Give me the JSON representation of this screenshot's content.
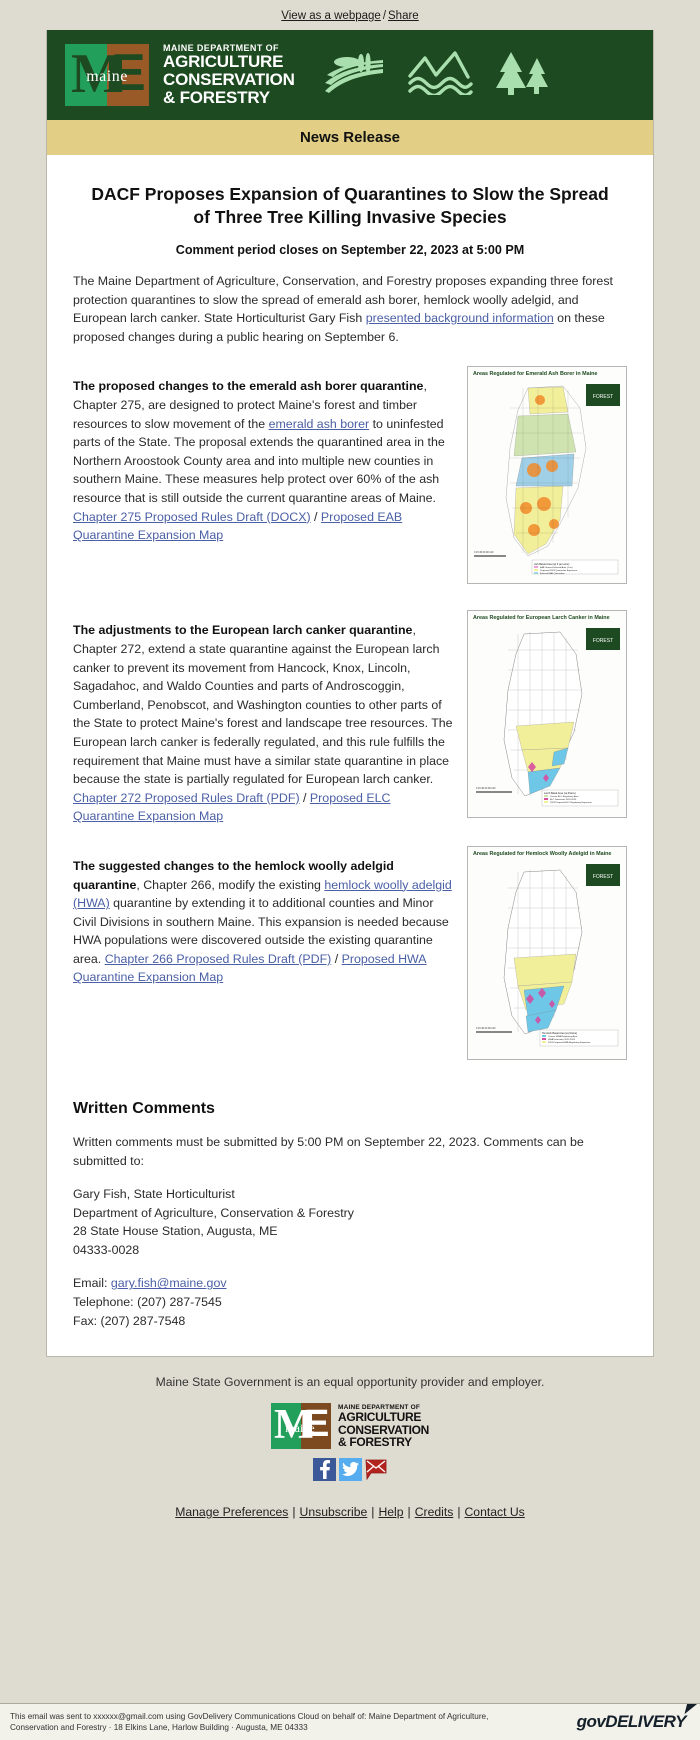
{
  "preheader": {
    "view_webpage": "View as a webpage",
    "separator": "/",
    "share": "Share"
  },
  "banner": {
    "logo_m": "M",
    "logo_e": "E",
    "logo_word": "maine",
    "dept_line1": "MAINE DEPARTMENT OF",
    "dept_line2": "AGRICULTURE",
    "dept_line3": "CONSERVATION",
    "dept_line4": "& FORESTRY",
    "icons": [
      "farm-field-icon",
      "mountain-water-icon",
      "pine-trees-icon"
    ]
  },
  "news_strip": {
    "label": "News Release"
  },
  "article": {
    "headline": "DACF Proposes Expansion of Quarantines to Slow the Spread of Three Tree Killing Invasive Species",
    "subhead": "Comment period closes on September 22, 2023 at 5:00 PM",
    "intro_part1": "The Maine Department of Agriculture, Conservation, and Forestry proposes expanding three forest protection quarantines to slow the spread of emerald ash borer, hemlock woolly adelgid, and European larch canker. State Horticulturist Gary Fish ",
    "intro_link": "presented background information",
    "intro_part2": " on these proposed changes during a public hearing on September 6."
  },
  "sections": [
    {
      "id": "eab",
      "lead_bold": "The proposed changes to the emerald ash borer quarantine",
      "text_1": ", Chapter 275, are designed to protect Maine's forest and timber resources to slow movement of the ",
      "inline_link": "emerald ash borer",
      "text_2": " to uninfested parts of the State. The proposal extends the quarantined area in the Northern Aroostook County area and into multiple new counties in southern Maine. These measures help protect over 60% of the ash resource that is still outside the current quarantine areas of Maine. ",
      "link_a": "Chapter 275 Proposed Rules Draft (DOCX)",
      "link_divider": " / ",
      "link_b": "Proposed EAB Quarantine Expansion Map",
      "map": {
        "name": "eab-quarantine-map",
        "caption": "Areas Regulated for Emerald Ash Borer in Maine",
        "legend_title": "Ash Basal Area (sq ft per acre)",
        "legend_items": [
          "EAB General Infested Area (1 mi)",
          "EAB Potential Infested Area (10 mi)",
          "Existing Maine EAB Quarantine",
          "Proposed 2023 Quarantine Expansion",
          "External EAB Quarantine",
          "Canada Non-Regulated Area"
        ]
      }
    },
    {
      "id": "elc",
      "lead_bold": "The adjustments to the European larch canker quarantine",
      "text_1": ", Chapter 272, extend a state quarantine against the European larch canker to prevent its movement from Hancock, Knox, Lincoln, Sagadahoc, and Waldo Counties and parts of Androscoggin, Cumberland, Penobscot, and Washington counties to other parts of the State to protect Maine's forest and landscape tree resources. The European larch canker is federally regulated, and this rule fulfills the requirement that Maine must have a similar state quarantine in place because the state is partially regulated for European larch canker. ",
      "inline_link": "",
      "text_2": "",
      "link_a": "Chapter 272 Proposed Rules Draft (PDF)",
      "link_divider": " / ",
      "link_b": "Proposed ELC Quarantine Expansion Map",
      "map": {
        "name": "elc-quarantine-map",
        "caption": "Areas Regulated for European Larch Canker in Maine",
        "legend_title": "Larch Basal Area (sq ft per acre)",
        "legend_items": [
          "Current ELC Regulatory Area",
          "ELC Detections 2022-2023",
          "2023 Proposed ELC Regulatory Expansion"
        ]
      }
    },
    {
      "id": "hwa",
      "lead_bold": "The suggested changes to the hemlock woolly adelgid quarantine",
      "text_1": ", Chapter 266, modify the existing ",
      "inline_link": "hemlock woolly adelgid (HWA)",
      "text_2": " quarantine by extending it to additional counties and Minor Civil Divisions in southern Maine. This expansion is needed because HWA populations were discovered outside the existing quarantine area. ",
      "link_a": "Chapter 266 Proposed Rules Draft (PDF)",
      "link_divider": " / ",
      "link_b": "Proposed HWA Quarantine Expansion Map",
      "map": {
        "name": "hwa-quarantine-map",
        "caption": "Areas Regulated for Hemlock Woolly Adelgid in Maine",
        "legend_title": "Hemlock Basal Area (sq ft per acre)",
        "legend_items": [
          "Current HWA Regulatory Area",
          "HWA Detections 2022-2023",
          "2023 Proposed HWA Regulatory Expansion"
        ]
      }
    }
  ],
  "written_comments": {
    "heading": "Written Comments",
    "line_1": "Written comments must be submitted by 5:00 PM on September 22, 2023. Comments can be submitted to:",
    "name": "Gary Fish, State Horticulturist",
    "department": "Department of Agriculture, Conservation & Forestry",
    "address": "28 State House Station, Augusta, ME",
    "zip": "04333-0028",
    "email_label": "Email: ",
    "email": "gary.fish@maine.gov",
    "telephone": "Telephone: (207) 287-7545",
    "fax": "Fax: (207) 287-7548"
  },
  "footer": {
    "eeo": "Maine State Government is an equal opportunity provider and employer.",
    "logo_m": "M",
    "logo_e": "E",
    "logo_word": "maine",
    "dept_line1": "MAINE DEPARTMENT OF",
    "dept_line2": "AGRICULTURE",
    "dept_line3": "CONSERVATION",
    "dept_line4": "& FORESTRY",
    "social": [
      {
        "name": "facebook-icon",
        "glyph": "f"
      },
      {
        "name": "twitter-icon",
        "glyph": "t"
      },
      {
        "name": "email-icon",
        "glyph": "m"
      }
    ],
    "links": [
      "Manage Preferences",
      "Unsubscribe",
      "Help",
      "Credits",
      "Contact Us"
    ],
    "separator": "|"
  },
  "govdelivery": {
    "text_line1": "This email was sent to xxxxxx@gmail.com using GovDelivery Communications Cloud on behalf of: Maine Department of Agriculture,",
    "text_line2": "Conservation and Forestry · 18 Elkins Lane, Harlow Building · Augusta, ME 04333",
    "brand": "govDELIVERY"
  },
  "colors": {
    "banner_green": "#1d4a20",
    "strip_gold": "#e2cf85",
    "page_bg": "#dedcd0",
    "link_blue": "#4a5fa5",
    "logo_green": "#22a05b",
    "logo_brown": "#9a5a28"
  }
}
